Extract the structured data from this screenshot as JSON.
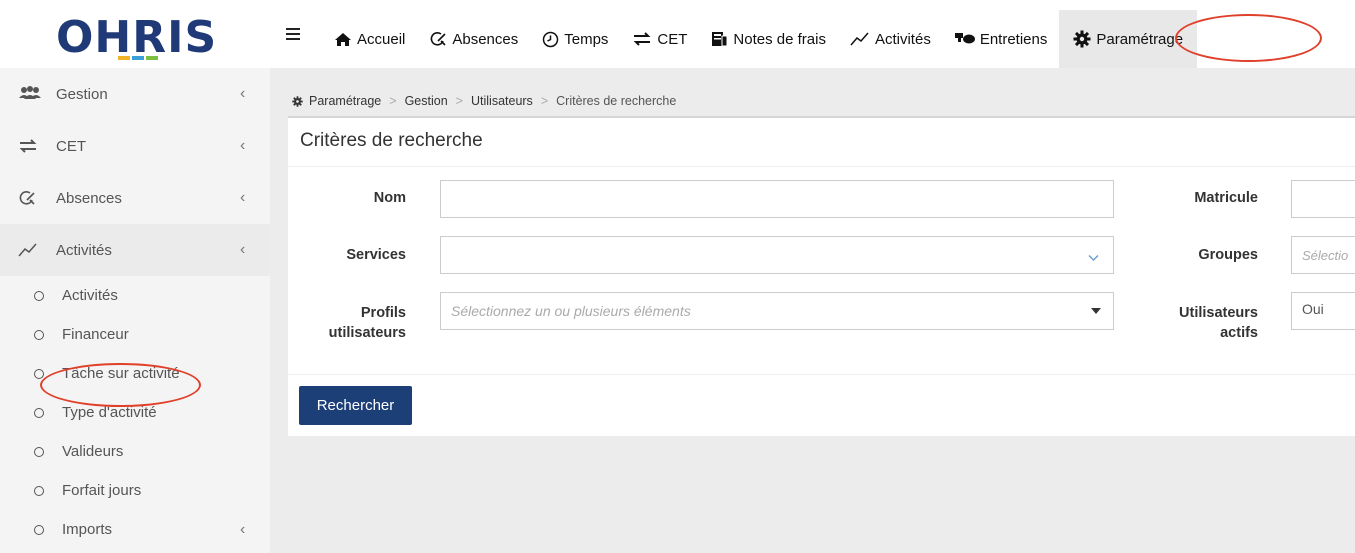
{
  "logo": {
    "text": "OHRIS",
    "bar_colors": [
      "#1f3a77",
      "#f0b429",
      "#3aa0d8",
      "#7bbf43"
    ]
  },
  "topnav": {
    "items": [
      {
        "label": "Accueil",
        "icon": "home-icon"
      },
      {
        "label": "Absences",
        "icon": "absence-icon"
      },
      {
        "label": "Temps",
        "icon": "clock-icon"
      },
      {
        "label": "CET",
        "icon": "transfer-icon"
      },
      {
        "label": "Notes de frais",
        "icon": "receipt-icon"
      },
      {
        "label": "Activités",
        "icon": "chart-line-icon"
      },
      {
        "label": "Entretiens",
        "icon": "chat-icon"
      },
      {
        "label": "Paramétrage",
        "icon": "gear-icon",
        "active": true
      }
    ]
  },
  "sidebar": {
    "items": [
      {
        "label": "Gestion",
        "icon": "users-icon"
      },
      {
        "label": "CET",
        "icon": "transfer-icon"
      },
      {
        "label": "Absences",
        "icon": "absence-icon"
      },
      {
        "label": "Activités",
        "icon": "chart-line-icon",
        "active": true
      }
    ],
    "subitems": [
      {
        "label": "Activités"
      },
      {
        "label": "Financeur"
      },
      {
        "label": "Tâche sur activité"
      },
      {
        "label": "Type d'activité"
      },
      {
        "label": "Valideurs"
      },
      {
        "label": "Forfait jours"
      },
      {
        "label": "Imports"
      }
    ]
  },
  "breadcrumb": {
    "items": [
      "Paramétrage",
      "Gestion",
      "Utilisateurs"
    ],
    "current": "Critères de recherche"
  },
  "panel": {
    "title": "Critères de recherche"
  },
  "form": {
    "nom_label": "Nom",
    "nom_value": "",
    "matricule_label": "Matricule",
    "services_label": "Services",
    "groupes_label": "Groupes",
    "groupes_placeholder": "Sélectio",
    "profils_label_1": "Profils",
    "profils_label_2": "utilisateurs",
    "profils_placeholder": "Sélectionnez un ou plusieurs éléments",
    "actifs_label_1": "Utilisateurs",
    "actifs_label_2": "actifs",
    "actifs_value": "Oui",
    "search_button": "Rechercher"
  },
  "colors": {
    "accent": "#1d3f78",
    "highlight_oval": "#e0402a"
  }
}
